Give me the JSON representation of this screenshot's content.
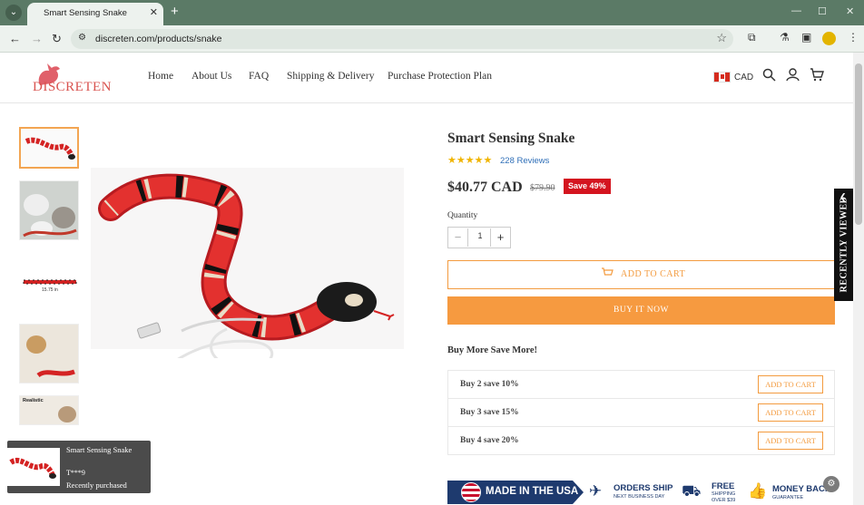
{
  "browser": {
    "tab_title": "Smart Sensing Snake",
    "tab_close": "✕",
    "new_tab": "+",
    "url": "discreten.com/products/snake",
    "window_controls": [
      "—",
      "☐",
      "✕"
    ]
  },
  "header": {
    "logo_text": "DISCRETEN",
    "nav": [
      "Home",
      "About Us",
      "FAQ",
      "Shipping & Delivery",
      "Purchase Protection Plan"
    ],
    "currency": "CAD"
  },
  "product": {
    "title": "Smart Sensing Snake",
    "stars": "★★★★★",
    "rating": 5,
    "reviews": "228 Reviews",
    "price": "$40.77 CAD",
    "compare_price": "$79.90",
    "save_badge": "Save 49%",
    "quantity_label": "Quantity",
    "quantity_value": "1",
    "add_to_cart": "ADD TO CART",
    "buy_now": "BUY IT NOW",
    "bundle_heading": "Buy More Save More!",
    "bundles": [
      {
        "label": "Buy 2 save 10%",
        "button": "ADD TO CART"
      },
      {
        "label": "Buy 3 save 15%",
        "button": "ADD TO CART"
      },
      {
        "label": "Buy 4 save 20%",
        "button": "ADD TO CART"
      }
    ],
    "thumb_texts": [
      "15.75 in",
      "Realistic"
    ]
  },
  "recently_viewed": "RECENTLY VIEWED",
  "badges": {
    "usa": "MADE IN THE USA",
    "orders_ship_1": "ORDERS SHIP",
    "orders_ship_2": "NEXT BUSINESS DAY",
    "free_1": "FREE",
    "free_2": "SHIPPING",
    "free_3": "OVER $39",
    "money_1": "MONEY BACK",
    "money_2": "GUARANTEE"
  },
  "popup": {
    "title": "Smart Sensing Snake",
    "user": "T***9",
    "status": "Recently purchased"
  },
  "colors": {
    "accent": "#f69a40",
    "sale": "#d4141f",
    "star": "#f0b400",
    "chrome": "#5b7a66"
  }
}
